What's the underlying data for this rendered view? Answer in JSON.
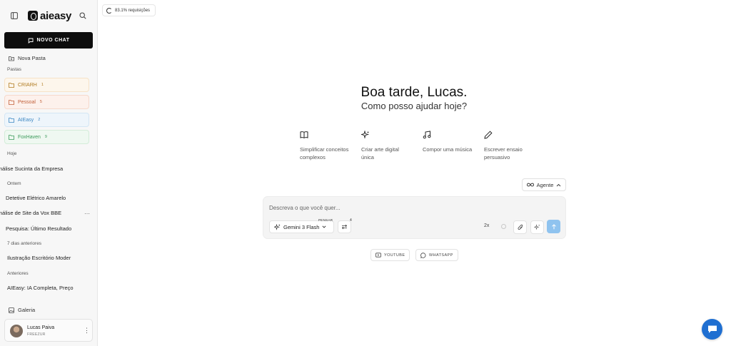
{
  "app": {
    "logo_text": "aieasy",
    "usage_text": "83.1% requisições"
  },
  "sidebar": {
    "new_chat_label": "NOVO CHAT",
    "new_folder_label": "Nova Pasta",
    "folders_heading": "Pastas",
    "folders": [
      {
        "name": "CRIARH",
        "count": "1",
        "bg": "#fdf6ec",
        "border": "#f6e3c8",
        "color": "#b07a1e"
      },
      {
        "name": "Pessoal",
        "count": "5",
        "bg": "#fdf1ec",
        "border": "#f6d9cc",
        "color": "#c2603a"
      },
      {
        "name": "AIEasy",
        "count": "2",
        "bg": "#eef5fb",
        "border": "#d4e6f4",
        "color": "#3a86c2"
      },
      {
        "name": "FoxHaven",
        "count": "9",
        "bg": "#eff8f1",
        "border": "#d3ecd9",
        "color": "#3b9a5a"
      }
    ],
    "groups": [
      {
        "label": "Hoje",
        "items": [
          "Análise Sucinta da Empresa"
        ]
      },
      {
        "label": "Ontem",
        "items": [
          "Detetive Elétrico Amarelo",
          "Análise de Site da Vox BBE",
          "Pesquisa: Último Resultado"
        ]
      },
      {
        "label": "7 dias anteriores",
        "items": [
          "Ilustração Escritório Moder"
        ]
      },
      {
        "label": "Anteriores",
        "items": [
          "AIEasy: IA Completa, Preço"
        ]
      }
    ],
    "gallery_label": "Galeria",
    "user": {
      "name": "Lucas Paiva",
      "plan": "FREEZUR"
    }
  },
  "main": {
    "greeting": "Boa tarde, Lucas.",
    "subgreeting": "Como posso ajudar hoje?",
    "suggestions": [
      {
        "icon": "book-icon",
        "text": "Simplificar conceitos complexos"
      },
      {
        "icon": "sparkles-icon",
        "text": "Criar arte digital única"
      },
      {
        "icon": "music-icon",
        "text": "Compor uma música"
      },
      {
        "icon": "pen-icon",
        "text": "Escrever ensaio persuasivo"
      }
    ],
    "agent_label": "Agente",
    "input_placeholder": "Descreva o que você quer...",
    "model_label": "Gemini 3 Flash",
    "think_label": "PENSAR",
    "swap_badge": "4",
    "speed_label": "2x",
    "chips": [
      {
        "icon": "video-icon",
        "label": "YOUTUBE"
      },
      {
        "icon": "whatsapp-icon",
        "label": "WHATSAPP"
      }
    ]
  }
}
